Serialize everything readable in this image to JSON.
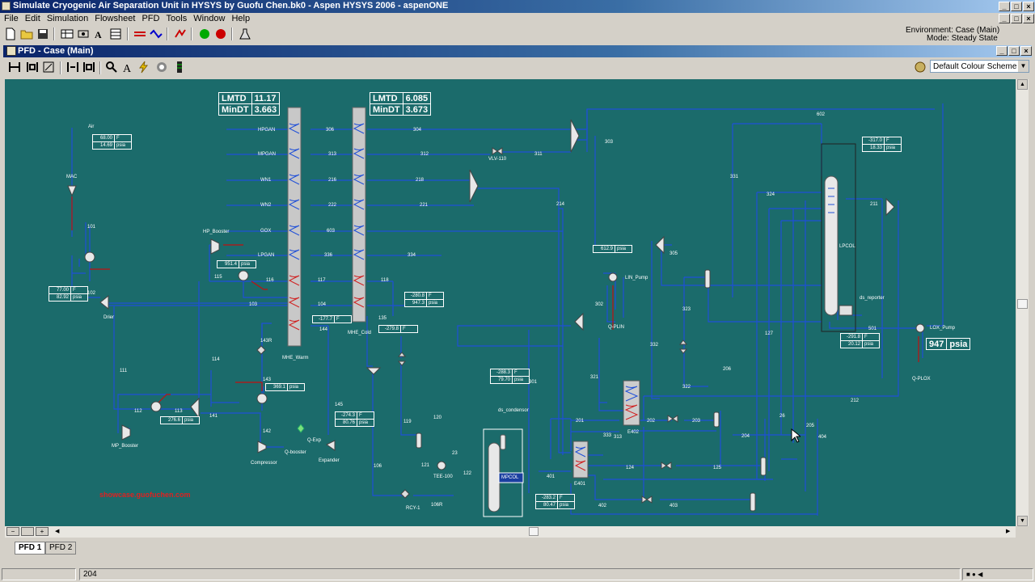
{
  "app": {
    "title": "Simulate Cryogenic Air Separation Unit in HYSYS by Guofu Chen.bk0 - Aspen HYSYS 2006 - aspenONE"
  },
  "menu": [
    "File",
    "Edit",
    "Simulation",
    "Flowsheet",
    "PFD",
    "Tools",
    "Window",
    "Help"
  ],
  "environment": {
    "line1": "Environment: Case (Main)",
    "line2": "Mode: Steady State"
  },
  "pfd_window": {
    "title": "PFD - Case (Main)",
    "colour_scheme": "Default Colour Scheme"
  },
  "tabs": [
    "PFD 1",
    "PFD 2"
  ],
  "status": {
    "left": "",
    "value": "204"
  },
  "lmtd_warm": {
    "lmtd_label": "LMTD",
    "lmtd": "11.17",
    "mindt_label": "MinDT",
    "mindt": "3.663"
  },
  "lmtd_cold": {
    "lmtd_label": "LMTD",
    "lmtd": "6.085",
    "mindt_label": "MinDT",
    "mindt": "3.673"
  },
  "lox_pressure": {
    "value": "947",
    "unit": "psia"
  },
  "watermark": "showcase.guofuchen.com",
  "stream_boxes": [
    {
      "id": "air",
      "v1": "68.00",
      "u1": "F",
      "v2": "14.69",
      "u2": "psia"
    },
    {
      "id": "hpb",
      "v1": "951.4",
      "u1": "psia"
    },
    {
      "id": "drier",
      "v1": "77.00",
      "u1": "F",
      "v2": "82.92",
      "u2": "psia"
    },
    {
      "id": "mpb",
      "v1": "276.6",
      "u1": "psia"
    },
    {
      "id": "exp",
      "v1": "369.1",
      "u1": "psia"
    },
    {
      "id": "s144",
      "v1": "-177.7",
      "u1": "F"
    },
    {
      "id": "s145",
      "v1": "-274.3",
      "u1": "F",
      "v2": "80.76",
      "u2": "psia"
    },
    {
      "id": "s118",
      "v1": "-280.8",
      "u1": "F",
      "v2": "947.3",
      "u2": "psia"
    },
    {
      "id": "s135",
      "v1": "-279.8",
      "u1": "F"
    },
    {
      "id": "lin",
      "v1": "612.9",
      "u1": "psia"
    },
    {
      "id": "top",
      "v1": "-317.0",
      "u1": "F",
      "v2": "18.33",
      "u2": "psia"
    },
    {
      "id": "s301",
      "v1": "-288.3",
      "u1": "F",
      "v2": "79.70",
      "u2": "psia"
    },
    {
      "id": "s401",
      "v1": "-283.2",
      "u1": "F",
      "v2": "80.47",
      "u2": "psia"
    },
    {
      "id": "s501",
      "v1": "-291.8",
      "u1": "F",
      "v2": "20.12",
      "u2": "psia"
    }
  ],
  "labels": {
    "air": "Air",
    "mac": "MAC",
    "s101": "101",
    "s102": "102",
    "drier": "Drier",
    "s103": "103",
    "hp_booster": "HP_Booster",
    "s115": "115",
    "s116": "116",
    "s114": "114",
    "s111": "111",
    "s112": "112",
    "s113": "113",
    "s141": "141",
    "mp_booster": "MP_Booster",
    "compressor": "Compressor",
    "q_booster": "Q-booster",
    "q_exp": "Q-Exp",
    "expander": "Expander",
    "s142": "142",
    "s143": "143",
    "s143r": "143R",
    "hpgan": "HPGAN",
    "mpgan": "MPGAN",
    "wn1": "WN1",
    "wn2": "WN2",
    "gox": "GOX",
    "lpgan": "LPGAN",
    "mhe_warm": "MHE_Warm",
    "mhe_cold": "MHE_Cold",
    "s306": "306",
    "s313": "313",
    "s216": "216",
    "s222": "222",
    "s603": "603",
    "s336": "336",
    "s117": "117",
    "s104": "104",
    "s304": "304",
    "s312": "312",
    "s218": "218",
    "s221": "221",
    "s334": "334",
    "s118": "118",
    "s135": "135",
    "s144": "144",
    "s145": "145",
    "s119": "119",
    "s120": "120",
    "s121": "121",
    "s122": "122",
    "s23": "23",
    "tee100": "TEE-100",
    "s106": "106",
    "rcy": "RCY-1",
    "s106r": "106R",
    "mpcol": "MPCOL",
    "ds_cond": "ds_condensor",
    "vlv110": "VLV-110",
    "s311": "311",
    "s303": "303",
    "s214": "214",
    "s602": "602",
    "s331": "331",
    "s324": "324",
    "s211": "211",
    "lpcol": "LPCOL",
    "ds_reb": "ds_reporter",
    "s305": "305",
    "lin_pump": "LIN_Pump",
    "q_plin": "Q-PLIN",
    "s302": "302",
    "s323": "323",
    "s321": "321",
    "s322": "322",
    "s332": "332",
    "s301": "301",
    "s201": "201",
    "s202": "202",
    "s203": "203",
    "s204": "204",
    "s205": "205",
    "s206": "206",
    "s212": "212",
    "s333": "333",
    "s313b": "313",
    "e402": "E402",
    "e401": "E401",
    "s401": "401",
    "s402": "402",
    "s403": "403",
    "s124": "124",
    "s125": "125",
    "s127": "127",
    "s26": "26",
    "s404": "404",
    "s501": "501",
    "lox_pump": "LOX_Pump",
    "q_plox": "Q-PLOX"
  }
}
